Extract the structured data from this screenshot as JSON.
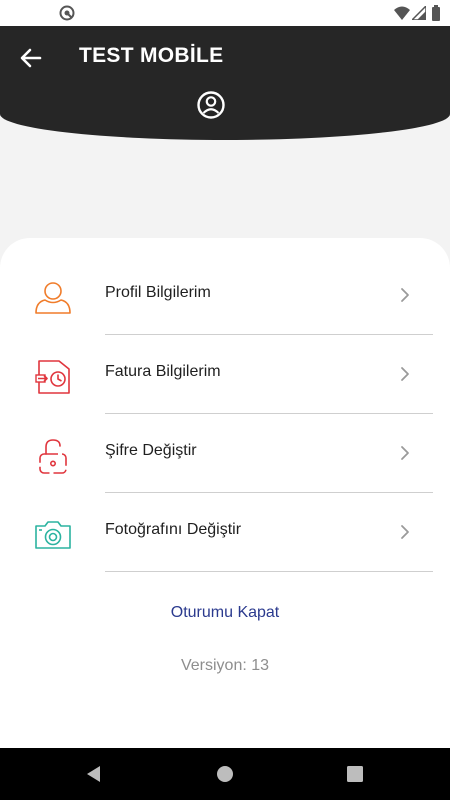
{
  "status_bar": {
    "icons": [
      "app-notification-icon",
      "wifi-icon",
      "cell-signal-icon",
      "battery-icon"
    ]
  },
  "header": {
    "title": "TEST MOBİLE",
    "back_icon": "arrow-left-icon",
    "avatar_icon": "account-circle-icon",
    "background": "#262626"
  },
  "menu": {
    "items": [
      {
        "label": "Profil Bilgilerim",
        "icon": "user-outline-icon",
        "color": "#f07c2a"
      },
      {
        "label": "Fatura Bilgilerim",
        "icon": "invoice-icon",
        "color": "#e0353d"
      },
      {
        "label": "Şifre Değiştir",
        "icon": "lock-icon",
        "color": "#e0353d"
      },
      {
        "label": "Fotoğrafını Değiştir",
        "icon": "camera-icon",
        "color": "#2bb3a0"
      }
    ]
  },
  "logout_label": "Oturumu Kapat",
  "version_text": "Versiyon: 13",
  "colors": {
    "logout": "#2b3a8e",
    "version": "#8e8e8e"
  },
  "nav_bar": {
    "buttons": [
      "back-triangle-icon",
      "home-circle-icon",
      "recents-square-icon"
    ]
  }
}
